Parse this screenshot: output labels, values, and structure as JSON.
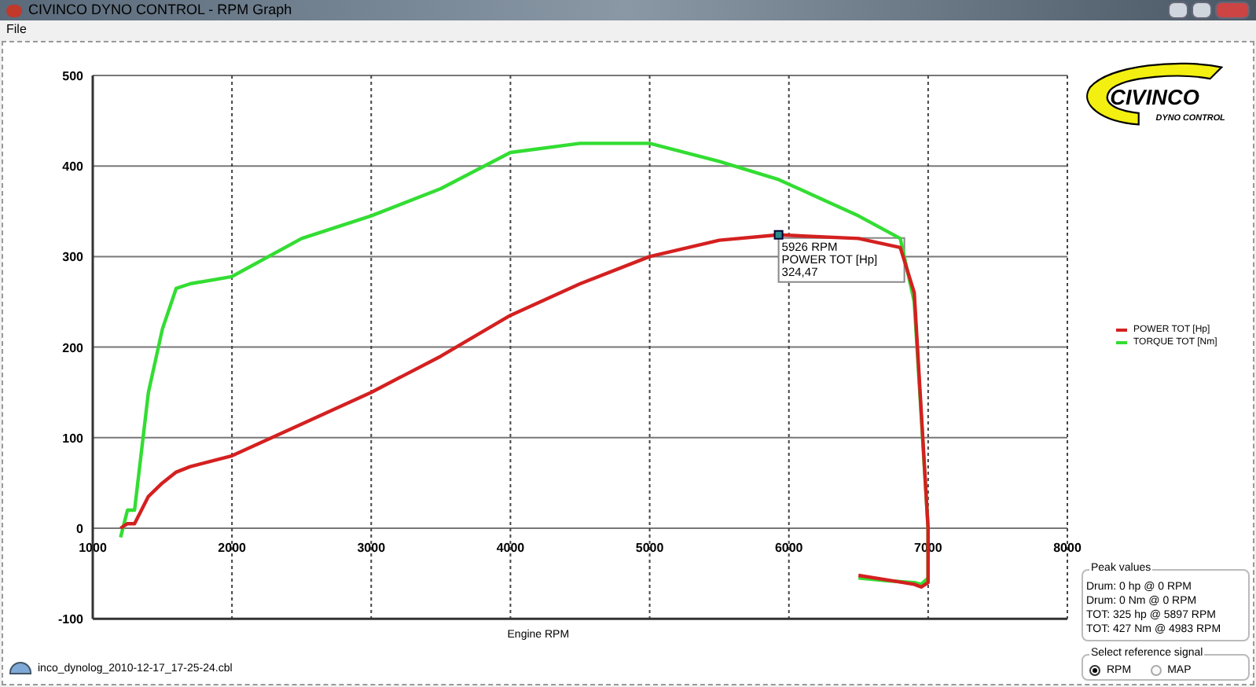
{
  "window": {
    "title": "CIVINCO DYNO CONTROL - RPM Graph"
  },
  "menu": [
    "File"
  ],
  "chart": {
    "chart_data": {
      "type": "line",
      "xlabel": "Engine RPM",
      "xlim": [
        1000,
        8000
      ],
      "ylim": [
        -100,
        500
      ],
      "xticks": [
        1000,
        2000,
        3000,
        4000,
        5000,
        6000,
        7000,
        8000
      ],
      "yticks": [
        -100,
        0,
        100,
        200,
        300,
        400,
        500
      ],
      "x": [
        1200,
        1250,
        1300,
        1400,
        1500,
        1600,
        1700,
        2000,
        2500,
        3000,
        3500,
        4000,
        4500,
        5000,
        5500,
        5926,
        6500,
        6800,
        6900,
        7000,
        7000,
        6950,
        6900,
        6700,
        6500
      ],
      "series": [
        {
          "name": "POWER TOT [Hp]",
          "color": "#d42020",
          "values": [
            0,
            5,
            5,
            35,
            50,
            62,
            68,
            80,
            115,
            150,
            190,
            235,
            270,
            300,
            318,
            324,
            320,
            310,
            260,
            0,
            -60,
            -65,
            -62,
            -57,
            -52
          ]
        },
        {
          "name": "TORQUE TOT [Nm]",
          "color": "#33dd33",
          "values": [
            -10,
            20,
            20,
            150,
            220,
            265,
            270,
            278,
            320,
            345,
            375,
            415,
            425,
            425,
            405,
            385,
            345,
            320,
            250,
            0,
            -55,
            -62,
            -60,
            -58,
            -55
          ]
        }
      ],
      "grid": true
    },
    "tooltip": {
      "lines": [
        "5926 RPM",
        "POWER TOT [Hp]",
        "324,47"
      ]
    }
  },
  "logo": {
    "name": "CIVINCO",
    "subtitle": "DYNO CONTROL"
  },
  "peak_values": {
    "title": "Peak values",
    "lines": [
      "Drum: 0 hp @ 0 RPM",
      "Drum: 0 Nm @ 0 RPM",
      "TOT: 325 hp @ 5897 RPM",
      "TOT: 427 Nm @ 4983 RPM"
    ]
  },
  "reference_signal": {
    "title": "Select reference signal",
    "options": [
      {
        "label": "RPM",
        "selected": true
      },
      {
        "label": "MAP",
        "selected": false
      }
    ]
  },
  "status": {
    "file": "inco_dynolog_2010-12-17_17-25-24.cbl"
  }
}
